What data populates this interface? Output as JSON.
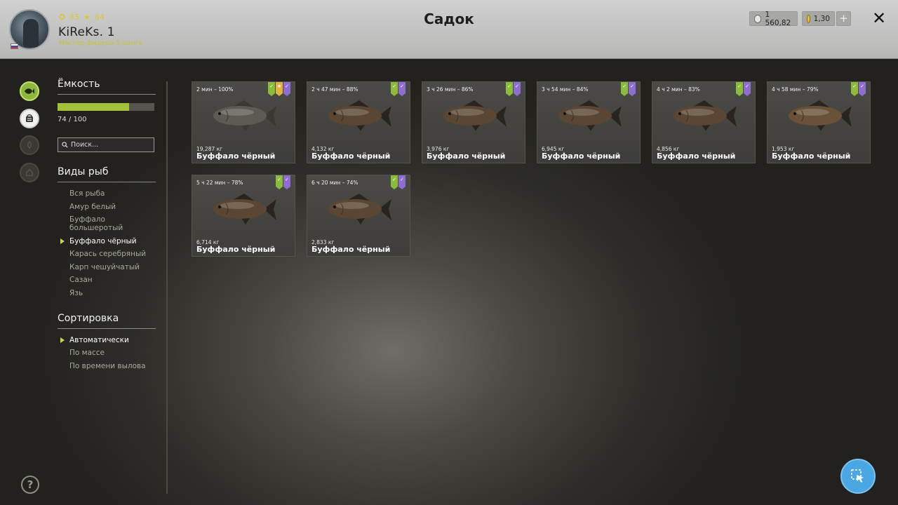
{
  "header": {
    "title": "Садок",
    "username": "KiReKs. 1",
    "rank": "Мастер фидера 5 ранга",
    "stat1": "45",
    "stat2": "84",
    "silver": "1 560,82",
    "gold": "1,30",
    "plus": "+",
    "close": "✕"
  },
  "sidebar": {
    "capacity": {
      "title": "Ёмкость",
      "filled": 74,
      "total": 100,
      "text": "74 / 100"
    },
    "search_placeholder": "Поиск...",
    "species": {
      "title": "Виды рыб",
      "items": [
        {
          "label": "Вся рыба",
          "active": false
        },
        {
          "label": "Амур белый",
          "active": false
        },
        {
          "label": "Буффало большеротый",
          "active": false
        },
        {
          "label": "Буффало чёрный",
          "active": true
        },
        {
          "label": "Карась серебряный",
          "active": false
        },
        {
          "label": "Карп чешуйчатый",
          "active": false
        },
        {
          "label": "Сазан",
          "active": false
        },
        {
          "label": "Язь",
          "active": false
        }
      ]
    },
    "sort": {
      "title": "Сортировка",
      "items": [
        {
          "label": "Автоматически",
          "active": true
        },
        {
          "label": "По массе",
          "active": false
        },
        {
          "label": "По времени вылова",
          "active": false
        }
      ]
    }
  },
  "fish": [
    {
      "time": "2 мин – 100%",
      "weight": "19,287 кг",
      "name": "Буффало чёрный",
      "badges": [
        "green",
        "gold",
        "violet"
      ],
      "body": "#5c5a52",
      "fin": "#3a3833"
    },
    {
      "time": "2 ч 47 мин – 88%",
      "weight": "4,132 кг",
      "name": "Буффало чёрный",
      "badges": [
        "green",
        "violet"
      ],
      "body": "#5a4633",
      "fin": "#2a2420"
    },
    {
      "time": "3 ч 26 мин – 86%",
      "weight": "3,976 кг",
      "name": "Буффало чёрный",
      "badges": [
        "green",
        "violet"
      ],
      "body": "#5a4633",
      "fin": "#2a2420"
    },
    {
      "time": "3 ч 54 мин – 84%",
      "weight": "6,945 кг",
      "name": "Буффало чёрный",
      "badges": [
        "green",
        "violet"
      ],
      "body": "#5a4633",
      "fin": "#2a2420"
    },
    {
      "time": "4 ч 2 мин – 83%",
      "weight": "4,856 кг",
      "name": "Буффало чёрный",
      "badges": [
        "green",
        "violet"
      ],
      "body": "#5a4633",
      "fin": "#2a2420"
    },
    {
      "time": "4 ч 58 мин – 79%",
      "weight": "1,953 кг",
      "name": "Буффало чёрный",
      "badges": [
        "green",
        "violet"
      ],
      "body": "#6a5238",
      "fin": "#2a2420"
    },
    {
      "time": "5 ч 22 мин – 78%",
      "weight": "6,714 кг",
      "name": "Буффало чёрный",
      "badges": [
        "green",
        "violet"
      ],
      "body": "#5a4633",
      "fin": "#2a2420"
    },
    {
      "time": "6 ч 20 мин – 74%",
      "weight": "2,833 кг",
      "name": "Буффало чёрный",
      "badges": [
        "green",
        "violet"
      ],
      "body": "#5a4633",
      "fin": "#2a2420"
    }
  ],
  "colors": {
    "accent_green": "#a3c23a",
    "badge_green": "#8bbd3a",
    "badge_gold": "#e4b43a",
    "badge_violet": "#8e6fd1",
    "cursor_button": "#4aa7e4"
  }
}
